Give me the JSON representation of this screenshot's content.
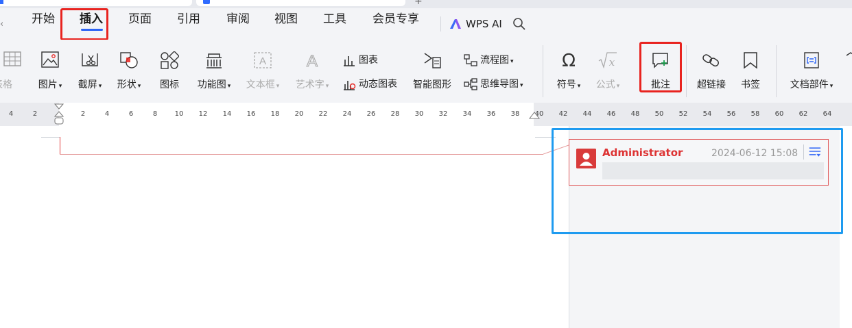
{
  "menu": {
    "items": [
      "开始",
      "插入",
      "页面",
      "引用",
      "审阅",
      "视图",
      "工具",
      "会员专享"
    ],
    "active": "插入",
    "wps_ai": "WPS AI",
    "accent": "#2b63f5"
  },
  "ribbon": {
    "table": "表格",
    "picture": "图片",
    "screenshot": "截屏",
    "shape": "形状",
    "icon": "图标",
    "function_chart": "功能图",
    "textbox": "文本框",
    "wordart": "艺术字",
    "chart": "图表",
    "dynamic_chart": "动态图表",
    "smart_shape": "智能图形",
    "flowchart": "流程图",
    "mindmap": "思维导图",
    "symbol": "符号",
    "formula": "公式",
    "comment": "批注",
    "hyperlink": "超链接",
    "bookmark": "书签",
    "doc_parts": "文档部件"
  },
  "ruler": {
    "ticks": [
      "4",
      "2",
      "2",
      "4",
      "6",
      "8",
      "10",
      "12",
      "14",
      "16",
      "18",
      "20",
      "22",
      "24",
      "26",
      "28",
      "30",
      "32",
      "34",
      "36",
      "38",
      "40",
      "42",
      "44",
      "46",
      "48",
      "50",
      "52",
      "54",
      "56",
      "58",
      "60",
      "62",
      "64"
    ]
  },
  "comment": {
    "author": "Administrator",
    "time": "2024-06-12 15:08",
    "author_color": "#d33333"
  },
  "highlight_colors": {
    "red": "#e8231f",
    "blue": "#1e9bf0"
  }
}
